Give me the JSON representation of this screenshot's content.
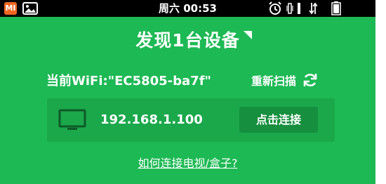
{
  "status_bar": {
    "brand_text": "MI",
    "time": "周六 00:53",
    "icons": [
      "gallery-icon",
      "alarm-icon",
      "vibrate-icon",
      "signal-icon",
      "data-icon",
      "battery-icon"
    ]
  },
  "header": {
    "title": "发现1台设备"
  },
  "wifi": {
    "label": "当前WiFi:\"EC5805-ba7f\"",
    "rescan_label": "重新扫描"
  },
  "devices": [
    {
      "ip": "192.168.1.100",
      "connect_label": "点击连接"
    }
  ],
  "help_link": "如何连接电视/盒子?",
  "colors": {
    "background": "#1db954",
    "card": "#1aa84b",
    "button": "#168f3f",
    "status_bar": "#000000",
    "text": "#ffffff"
  }
}
